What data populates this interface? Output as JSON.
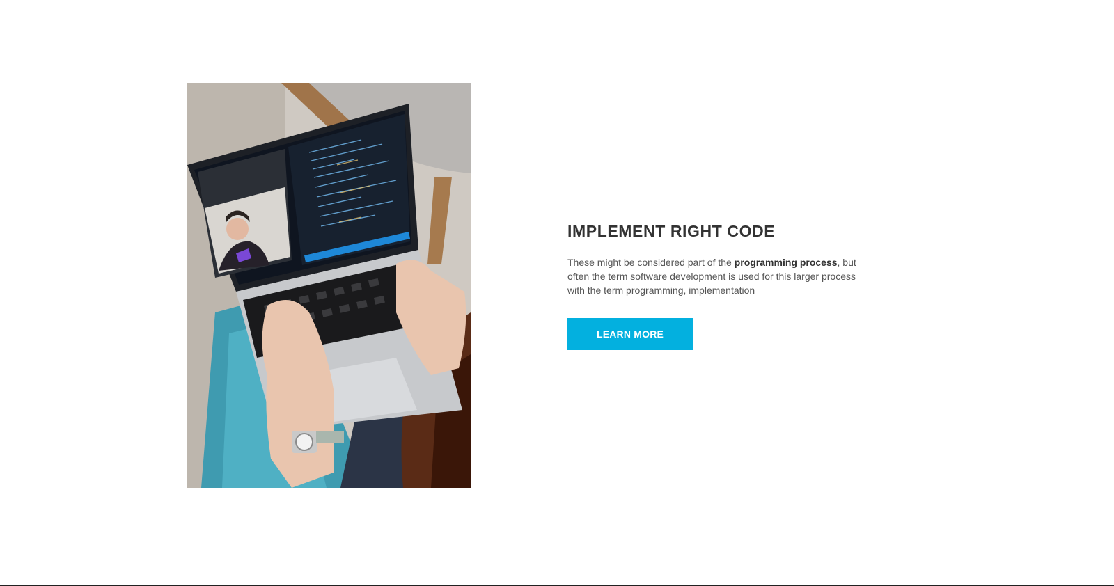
{
  "section": {
    "heading": "IMPLEMENT RIGHT CODE",
    "body_before": "These might be considered part of the ",
    "body_highlight": "programming process",
    "body_after": ", but often the term software development is used for this larger process with the term programming, implementation",
    "cta_label": "LEARN MORE"
  },
  "colors": {
    "accent": "#03b0df",
    "heading": "#333333",
    "body": "#555555"
  },
  "image": {
    "subject": "laptop-with-code-editor-and-video-call"
  }
}
